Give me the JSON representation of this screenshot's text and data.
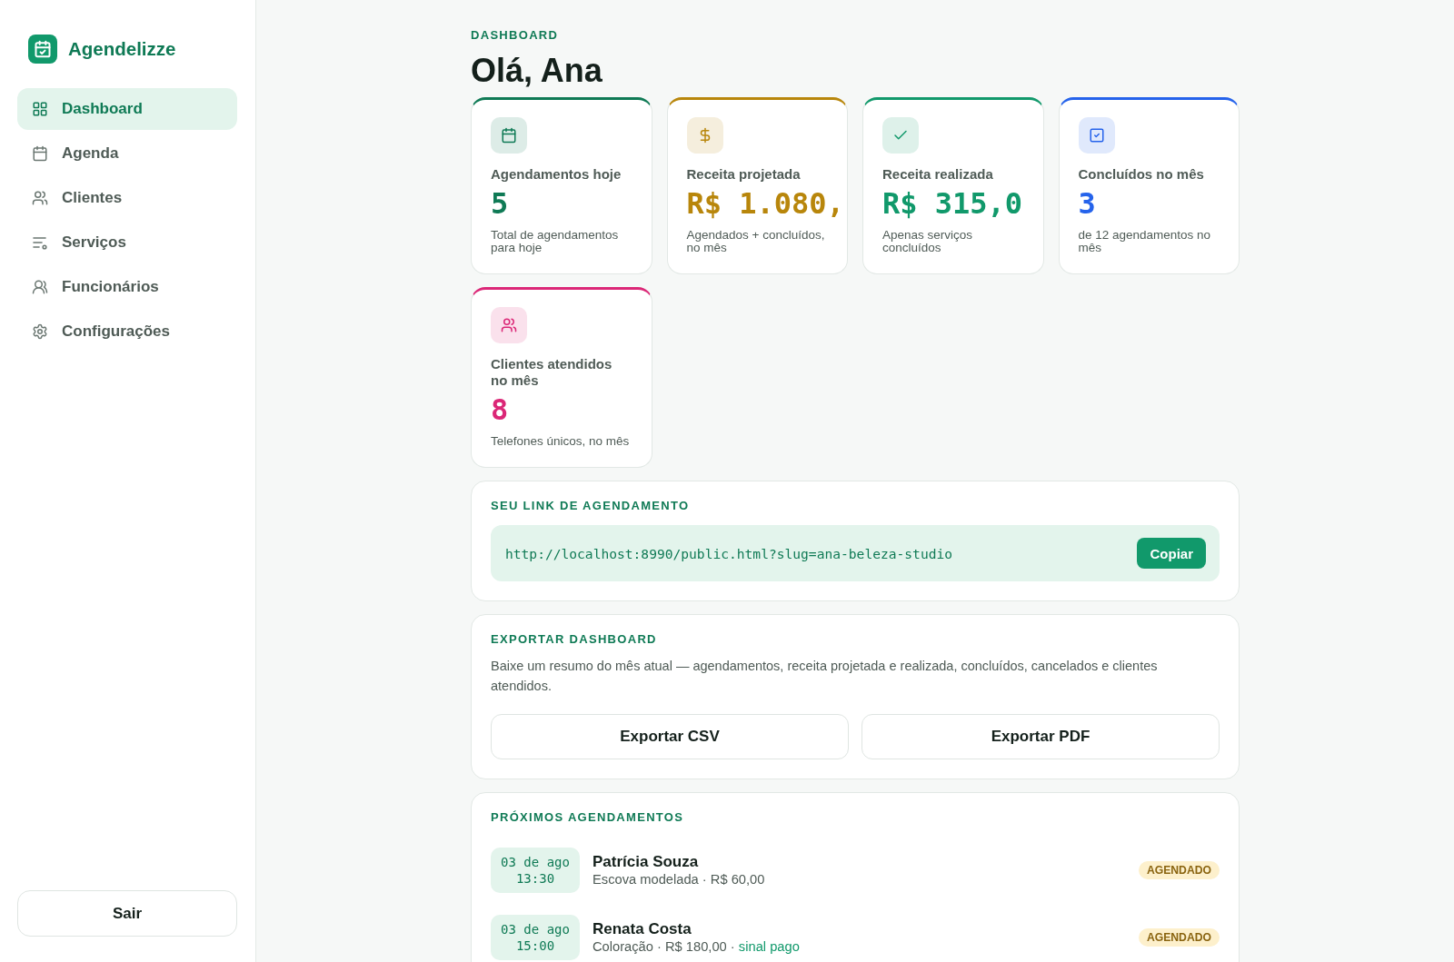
{
  "sidebar": {
    "brand": "Agendelizze",
    "items": [
      {
        "label": "Dashboard",
        "selected": true
      },
      {
        "label": "Agenda",
        "selected": false
      },
      {
        "label": "Clientes",
        "selected": false
      },
      {
        "label": "Serviços",
        "selected": false
      },
      {
        "label": "Funcionários",
        "selected": false
      },
      {
        "label": "Configurações",
        "selected": false
      }
    ],
    "logout": "Sair"
  },
  "header": {
    "eyebrow": "DASHBOARD",
    "title": "Olá, Ana"
  },
  "stats": [
    {
      "label": "Agendamentos hoje",
      "value": "5",
      "note": "Total de agendamentos para hoje",
      "color": "#0f7a55"
    },
    {
      "label": "Receita projetada",
      "value": "R$ 1.080,",
      "note": "Agendados + concluídos, no mês",
      "color": "#b8860b"
    },
    {
      "label": "Receita realizada",
      "value": "R$ 315,0",
      "note": "Apenas serviços concluídos",
      "color": "#11996b"
    },
    {
      "label": "Concluídos no mês",
      "value": "3",
      "note": "de 12 agendamentos no mês",
      "color": "#2563eb"
    },
    {
      "label": "Clientes atendidos no mês",
      "value": "8",
      "note": "Telefones únicos, no mês",
      "color": "#db2777"
    }
  ],
  "booking_link": {
    "title": "SEU LINK DE AGENDAMENTO",
    "url": "http://localhost:8990/public.html?slug=ana-beleza-studio",
    "button": "Copiar"
  },
  "export": {
    "title": "EXPORTAR DASHBOARD",
    "description": "Baixe um resumo do mês atual — agendamentos, receita projetada e realizada, concluídos, cancelados e clientes atendidos.",
    "buttons": [
      "Exportar CSV",
      "Exportar PDF"
    ]
  },
  "upcoming": {
    "title": "PRÓXIMOS AGENDAMENTOS",
    "items": [
      {
        "date": "03 de ago",
        "time": "13:30",
        "client": "Patrícia Souza",
        "detail": "Escova modelada · R$ 60,00",
        "status": "AGENDADO"
      },
      {
        "date": "03 de ago",
        "time": "15:00",
        "client": "Renata Costa",
        "detail": "Coloração · R$ 180,00 ·",
        "note": "sinal pago",
        "status": "AGENDADO"
      }
    ]
  }
}
